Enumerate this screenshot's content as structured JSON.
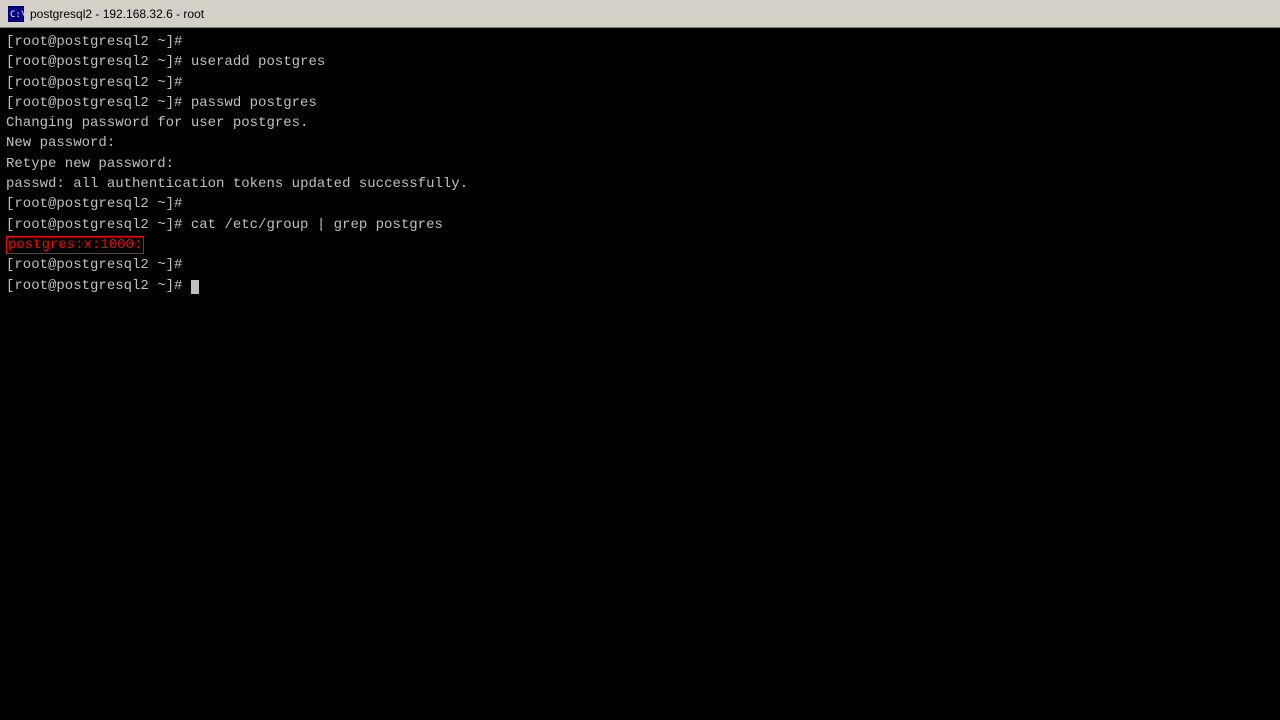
{
  "titleBar": {
    "title": "postgresql2 - 192.168.32.6 - root",
    "icon": "terminal-icon"
  },
  "terminal": {
    "lines": [
      {
        "id": "line1",
        "text": "[root@postgresql2 ~]#",
        "type": "prompt"
      },
      {
        "id": "line2",
        "text": "[root@postgresql2 ~]# useradd postgres",
        "type": "command"
      },
      {
        "id": "line3",
        "text": "[root@postgresql2 ~]#",
        "type": "prompt"
      },
      {
        "id": "line4",
        "text": "[root@postgresql2 ~]# passwd postgres",
        "type": "command"
      },
      {
        "id": "line5",
        "text": "Changing password for user postgres.",
        "type": "output"
      },
      {
        "id": "line6",
        "text": "New password:",
        "type": "output"
      },
      {
        "id": "line7",
        "text": "Retype new password:",
        "type": "output"
      },
      {
        "id": "line8",
        "text": "passwd: all authentication tokens updated successfully.",
        "type": "output"
      },
      {
        "id": "line9",
        "text": "[root@postgresql2 ~]#",
        "type": "prompt"
      },
      {
        "id": "line10",
        "text": "[root@postgresql2 ~]# cat /etc/group | grep postgres",
        "type": "command"
      },
      {
        "id": "line11",
        "highlighted": "postgres:x:1000:",
        "type": "highlighted"
      },
      {
        "id": "line12",
        "text": "[root@postgresql2 ~]#",
        "type": "prompt"
      },
      {
        "id": "line13",
        "text": "[root@postgresql2 ~]# ",
        "type": "cursor-line"
      }
    ]
  }
}
